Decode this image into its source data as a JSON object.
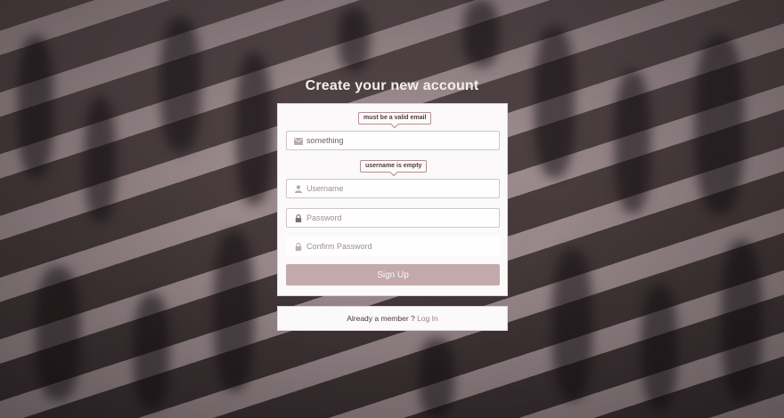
{
  "page": {
    "title": "Create your new account"
  },
  "form": {
    "email": {
      "value": "something",
      "error": "must be a valid email",
      "icon": "envelope-icon"
    },
    "username": {
      "value": "",
      "placeholder": "Username",
      "error": "username is empty",
      "icon": "user-icon"
    },
    "password": {
      "value": "",
      "placeholder": "Password",
      "icon": "lock-icon"
    },
    "confirm_password": {
      "value": "",
      "placeholder": "Confirm Password",
      "icon": "lock-icon"
    },
    "submit_label": "Sign Up"
  },
  "login_prompt": {
    "text": "Already a member ?",
    "link_label": "Log In"
  },
  "colors": {
    "accent": "#c4a9ac",
    "tooltip_border": "#b28e94",
    "card": "#fbf9f9"
  }
}
